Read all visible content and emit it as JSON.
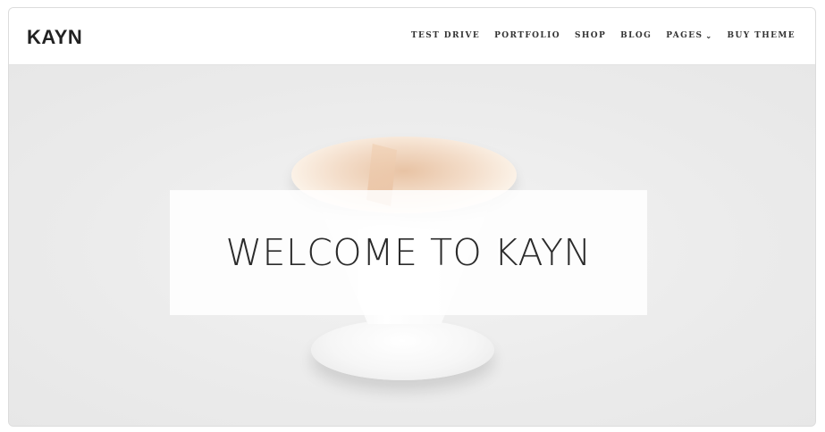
{
  "header": {
    "logo": "KAYN",
    "nav": [
      {
        "label": "TEST DRIVE"
      },
      {
        "label": "PORTFOLIO"
      },
      {
        "label": "SHOP"
      },
      {
        "label": "BLOG"
      },
      {
        "label": "PAGES",
        "has_dropdown": true,
        "icon": "chevron-down-icon",
        "chevron": "⌄"
      },
      {
        "label": "BUY THEME"
      }
    ]
  },
  "hero": {
    "title": "WELCOME TO KAYN",
    "image": "coffee-dripper"
  }
}
